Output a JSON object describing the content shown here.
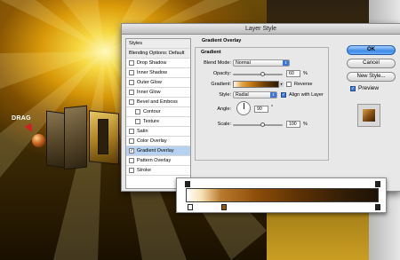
{
  "artwork": {
    "drag_label": "DRAG"
  },
  "dialog": {
    "title": "Layer Style",
    "styles": {
      "header": "Styles",
      "blending_options": "Blending Options: Default",
      "items": [
        {
          "label": "Drop Shadow",
          "checked": false
        },
        {
          "label": "Inner Shadow",
          "checked": false
        },
        {
          "label": "Outer Glow",
          "checked": false
        },
        {
          "label": "Inner Glow",
          "checked": false
        },
        {
          "label": "Bevel and Emboss",
          "checked": false
        },
        {
          "label": "Contour",
          "checked": false
        },
        {
          "label": "Texture",
          "checked": false
        },
        {
          "label": "Satin",
          "checked": false
        },
        {
          "label": "Color Overlay",
          "checked": false
        },
        {
          "label": "Gradient Overlay",
          "checked": true
        },
        {
          "label": "Pattern Overlay",
          "checked": false
        },
        {
          "label": "Stroke",
          "checked": false
        }
      ]
    },
    "gradient_overlay": {
      "section_title": "Gradient Overlay",
      "group_title": "Gradient",
      "blend_mode": {
        "label": "Blend Mode:",
        "value": "Normal"
      },
      "opacity": {
        "label": "Opacity:",
        "value": "60",
        "unit": "%",
        "level": 0.6
      },
      "gradient": {
        "label": "Gradient:",
        "reverse_label": "Reverse",
        "reverse_checked": false
      },
      "style": {
        "label": "Style:",
        "value": "Radial",
        "align_label": "Align with Layer",
        "align_checked": true
      },
      "angle": {
        "label": "Angle:",
        "value": "90",
        "unit": "°"
      },
      "scale": {
        "label": "Scale:",
        "value": "100",
        "unit": "%",
        "level": 0.6
      }
    },
    "buttons": {
      "ok": "OK",
      "cancel": "Cancel",
      "new_style": "New Style...",
      "preview_label": "Preview",
      "preview_checked": true
    }
  }
}
